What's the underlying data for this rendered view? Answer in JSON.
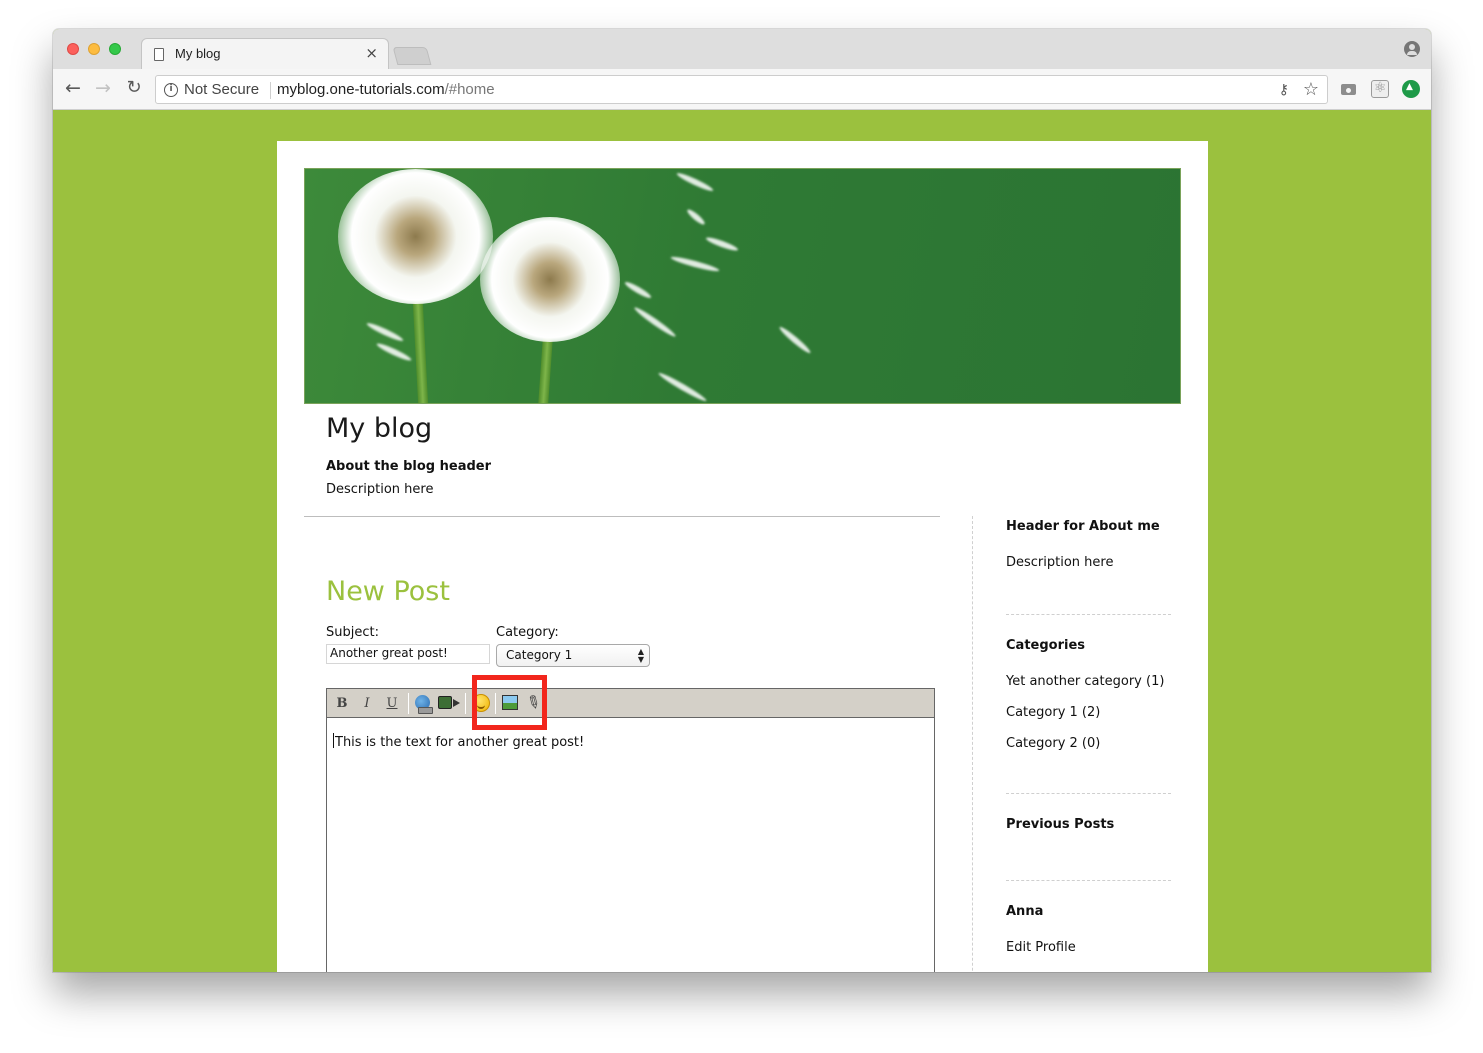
{
  "browser": {
    "tab_title": "My blog",
    "tab_close": "×",
    "security_label": "Not Secure",
    "url_host": "myblog.one-tutorials.com",
    "url_path": "/#home",
    "back": "←",
    "forward": "→",
    "reload": "↻",
    "info_glyph": "i",
    "key_glyph": "⚷",
    "star_glyph": "☆"
  },
  "blog": {
    "title": "My blog",
    "about_header": "About the blog header",
    "about_description": "Description here"
  },
  "new_post": {
    "heading": "New Post",
    "subject_label": "Subject:",
    "subject_value": "Another great post!",
    "category_label": "Category:",
    "category_value": "Category 1",
    "category_arrows": "▲\n▼",
    "editor_buttons": {
      "bold": "B",
      "italic": "I",
      "underline": "U",
      "attach": "✎"
    },
    "body_text": "This is the text for another great post!"
  },
  "sidebar": {
    "about_heading": "Header for About me",
    "about_text": "Description here",
    "categories_heading": "Categories",
    "categories": [
      "Yet another category (1)",
      "Category 1 (2)",
      "Category 2 (0)"
    ],
    "previous_posts_heading": "Previous Posts",
    "user_name": "Anna",
    "edit_profile": "Edit Profile"
  },
  "colors": {
    "page_background": "#9bc13e",
    "accent": "#9bc13e",
    "highlight": "#f2261c"
  }
}
